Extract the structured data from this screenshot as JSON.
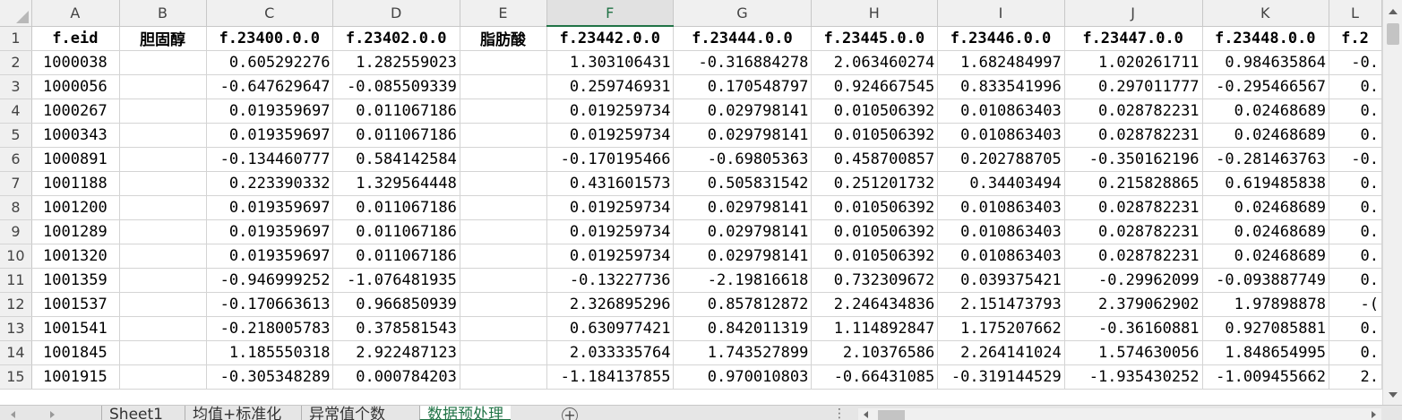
{
  "columns": [
    "A",
    "B",
    "C",
    "D",
    "E",
    "F",
    "G",
    "H",
    "I",
    "J",
    "K",
    "L"
  ],
  "row_numbers": [
    "1",
    "2",
    "3",
    "4",
    "5",
    "6",
    "7",
    "8",
    "9",
    "10",
    "11",
    "12",
    "13",
    "14",
    "15"
  ],
  "header_row": [
    "f.eid",
    "胆固醇",
    "f.23400.0.0",
    "f.23402.0.0",
    "脂肪酸",
    "f.23442.0.0",
    "f.23444.0.0",
    "f.23445.0.0",
    "f.23446.0.0",
    "f.23447.0.0",
    "f.23448.0.0",
    "f.2"
  ],
  "rows": [
    [
      "1000038",
      "",
      "0.605292276",
      "1.282559023",
      "",
      "1.303106431",
      "-0.316884278",
      "2.063460274",
      "1.682484997",
      "1.020261711",
      "0.984635864",
      "-0."
    ],
    [
      "1000056",
      "",
      "-0.647629647",
      "-0.085509339",
      "",
      "0.259746931",
      "0.170548797",
      "0.924667545",
      "0.833541996",
      "0.297011777",
      "-0.295466567",
      "0."
    ],
    [
      "1000267",
      "",
      "0.019359697",
      "0.011067186",
      "",
      "0.019259734",
      "0.029798141",
      "0.010506392",
      "0.010863403",
      "0.028782231",
      "0.02468689",
      "0."
    ],
    [
      "1000343",
      "",
      "0.019359697",
      "0.011067186",
      "",
      "0.019259734",
      "0.029798141",
      "0.010506392",
      "0.010863403",
      "0.028782231",
      "0.02468689",
      "0."
    ],
    [
      "1000891",
      "",
      "-0.134460777",
      "0.584142584",
      "",
      "-0.170195466",
      "-0.69805363",
      "0.458700857",
      "0.202788705",
      "-0.350162196",
      "-0.281463763",
      "-0."
    ],
    [
      "1001188",
      "",
      "0.223390332",
      "1.329564448",
      "",
      "0.431601573",
      "0.505831542",
      "0.251201732",
      "0.34403494",
      "0.215828865",
      "0.619485838",
      "0."
    ],
    [
      "1001200",
      "",
      "0.019359697",
      "0.011067186",
      "",
      "0.019259734",
      "0.029798141",
      "0.010506392",
      "0.010863403",
      "0.028782231",
      "0.02468689",
      "0."
    ],
    [
      "1001289",
      "",
      "0.019359697",
      "0.011067186",
      "",
      "0.019259734",
      "0.029798141",
      "0.010506392",
      "0.010863403",
      "0.028782231",
      "0.02468689",
      "0."
    ],
    [
      "1001320",
      "",
      "0.019359697",
      "0.011067186",
      "",
      "0.019259734",
      "0.029798141",
      "0.010506392",
      "0.010863403",
      "0.028782231",
      "0.02468689",
      "0."
    ],
    [
      "1001359",
      "",
      "-0.946999252",
      "-1.076481935",
      "",
      "-0.13227736",
      "-2.19816618",
      "0.732309672",
      "0.039375421",
      "-0.29962099",
      "-0.093887749",
      "0."
    ],
    [
      "1001537",
      "",
      "-0.170663613",
      "0.966850939",
      "",
      "2.326895296",
      "0.857812872",
      "2.246434836",
      "2.151473793",
      "2.379062902",
      "1.97898878",
      "-("
    ],
    [
      "1001541",
      "",
      "-0.218005783",
      "0.378581543",
      "",
      "0.630977421",
      "0.842011319",
      "1.114892847",
      "1.175207662",
      "-0.36160881",
      "0.927085881",
      "0."
    ],
    [
      "1001845",
      "",
      "1.185550318",
      "2.922487123",
      "",
      "2.033335764",
      "1.743527899",
      "2.10376586",
      "2.264141024",
      "1.574630056",
      "1.848654995",
      "0."
    ],
    [
      "1001915",
      "",
      "-0.305348289",
      "0.000784203",
      "",
      "-1.184137855",
      "0.970010803",
      "-0.66431085",
      "-0.319144529",
      "-1.935430252",
      "-1.009455662",
      "2."
    ]
  ],
  "selected_column": "F",
  "sheet_tabs": [
    "Sheet1",
    "均值+标准化",
    "异常值个数",
    "数据预处理"
  ],
  "active_tab": "数据预处理",
  "add_sheet_symbol": "+",
  "more_symbol": "⋮",
  "accent_color": "#217346"
}
